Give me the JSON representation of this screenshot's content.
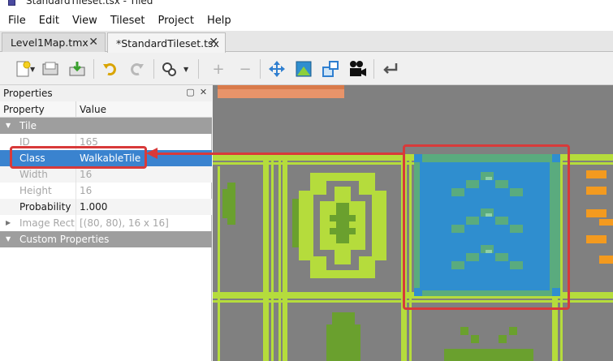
{
  "window": {
    "title": "StandardTileset.tsx - Tiled"
  },
  "menu": [
    "File",
    "Edit",
    "View",
    "Tileset",
    "Project",
    "Help"
  ],
  "tabs": [
    {
      "label": "Level1Map.tmx",
      "active": false
    },
    {
      "label": "*StandardTileset.tsx",
      "active": true
    }
  ],
  "toolbar": {
    "icons": [
      "new-file-icon",
      "open-file-icon",
      "save-icon",
      "undo-icon",
      "redo-icon",
      "settings-icon",
      "add-icon",
      "remove-icon",
      "move-icon",
      "image-icon",
      "shape-icon",
      "camera-icon",
      "return-icon"
    ]
  },
  "properties_panel": {
    "title": "Properties",
    "columns": {
      "property": "Property",
      "value": "Value"
    },
    "groups": {
      "tile": "Tile",
      "custom": "Custom Properties"
    },
    "rows": [
      {
        "name": "ID",
        "value": "165",
        "disabled": true
      },
      {
        "name": "Class",
        "value": "WalkableTile",
        "selected": true
      },
      {
        "name": "Width",
        "value": "16",
        "disabled": true
      },
      {
        "name": "Height",
        "value": "16",
        "disabled": true
      },
      {
        "name": "Probability",
        "value": "1.000"
      },
      {
        "name": "Image Rect",
        "value": "[(80, 80), 16 x 16]",
        "disabled": true
      }
    ]
  },
  "colors": {
    "accent_selection": "#3a83cf",
    "annotation_red": "#d83a3a",
    "tile_lime": "#b5dc3c",
    "tile_green": "#6aa02e",
    "tile_blue": "#2f8ecf",
    "tile_teal": "#5aab7e",
    "canvas_gray": "#808080"
  }
}
